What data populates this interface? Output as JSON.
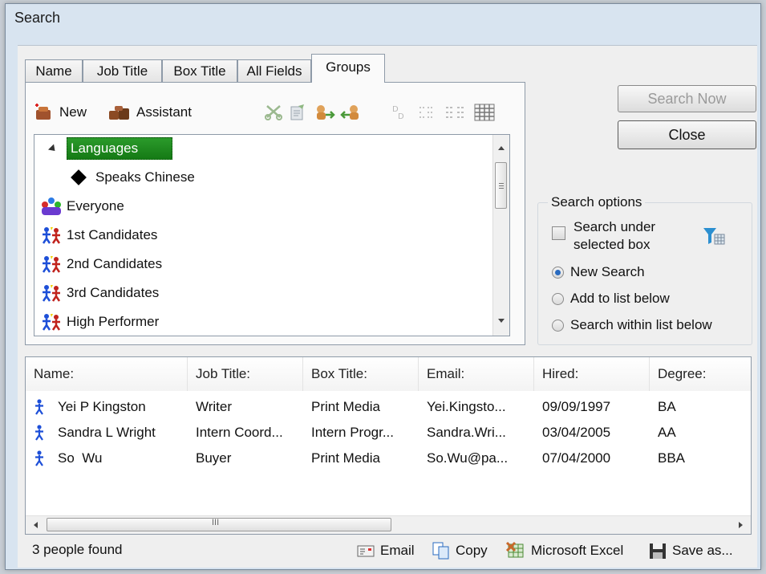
{
  "window": {
    "title": "Search"
  },
  "tabs": [
    "Name",
    "Job Title",
    "Box Title",
    "All Fields",
    "Groups"
  ],
  "toolbar": {
    "new_label": "New",
    "assistant_label": "Assistant"
  },
  "tree": [
    {
      "label": "Languages",
      "selected": true,
      "icon": "expander-icon"
    },
    {
      "label": "Speaks Chinese",
      "icon": "diamond-icon"
    },
    {
      "label": "Everyone",
      "icon": "group-icon"
    },
    {
      "label": "1st Candidates",
      "icon": "people-icon"
    },
    {
      "label": "2nd Candidates",
      "icon": "people-icon"
    },
    {
      "label": "3rd Candidates",
      "icon": "people-icon"
    },
    {
      "label": "High Performer",
      "icon": "people-icon"
    }
  ],
  "buttons": {
    "search_now": "Search Now",
    "close": "Close"
  },
  "search_options": {
    "legend": "Search options",
    "search_under": "Search under selected box",
    "radios": [
      "New Search",
      "Add to list below",
      "Search within list below"
    ],
    "selected_radio": 0
  },
  "results": {
    "columns": [
      "Name:",
      "Job Title:",
      "Box Title:",
      "Email:",
      "Hired:",
      "Degree:"
    ],
    "rows": [
      [
        "Yei P Kingston",
        "Writer",
        "Print Media",
        "Yei.Kingsto...",
        "09/09/1997",
        "BA"
      ],
      [
        "Sandra L Wright",
        "Intern Coord...",
        "Intern Progr...",
        "Sandra.Wri...",
        "03/04/2005",
        "AA"
      ],
      [
        "So  Wu",
        "Buyer",
        "Print Media",
        "So.Wu@pa...",
        "07/04/2000",
        "BBA"
      ]
    ],
    "scroll_grip": "III"
  },
  "status": {
    "count": "3 people found"
  },
  "actions": {
    "email": "Email",
    "copy": "Copy",
    "excel": "Microsoft Excel",
    "save_as": "Save as..."
  },
  "colors": {
    "selection": "#1e8a1e",
    "accent": "#2a6bc0"
  }
}
